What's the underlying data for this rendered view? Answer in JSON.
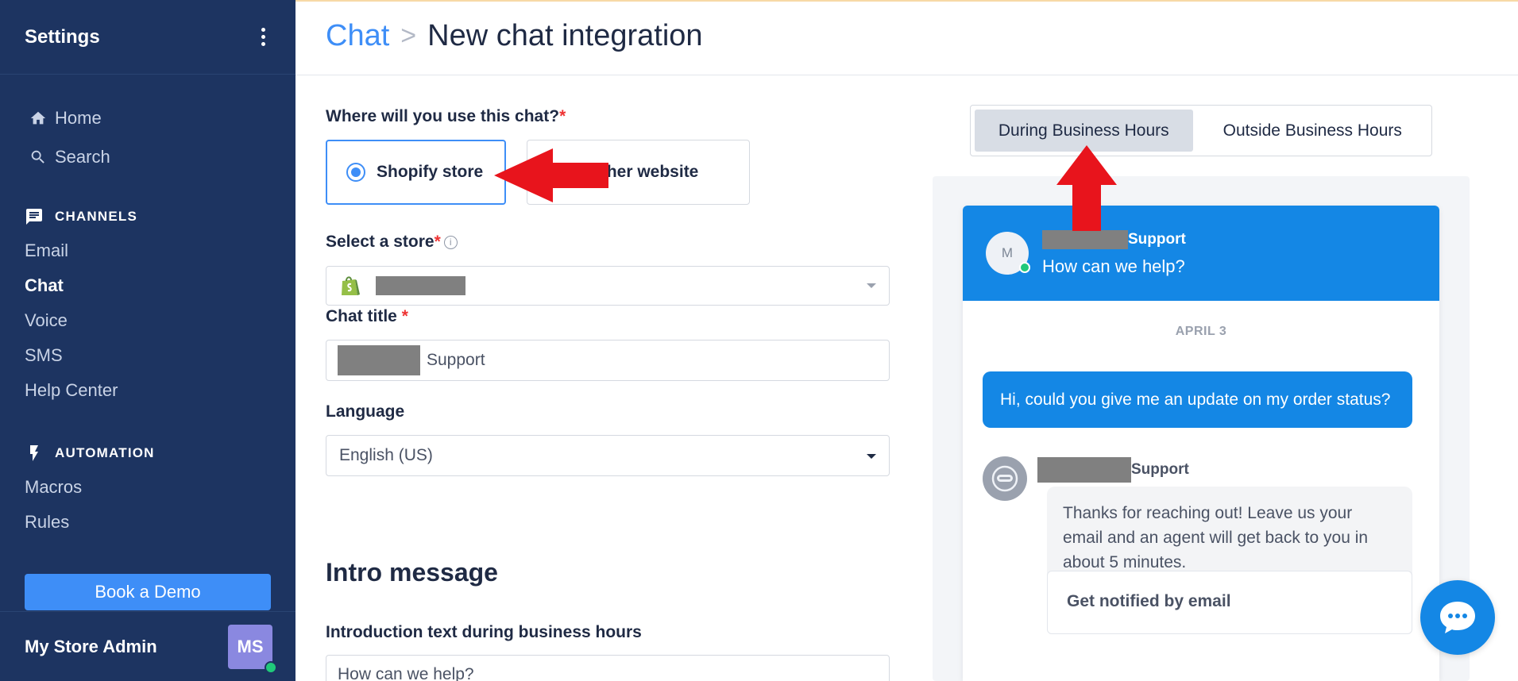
{
  "sidebar": {
    "title": "Settings",
    "nav": [
      {
        "label": "Home",
        "icon": "home-icon"
      },
      {
        "label": "Search",
        "icon": "search-icon"
      }
    ],
    "channels": {
      "heading": "CHANNELS",
      "items": [
        "Email",
        "Chat",
        "Voice",
        "SMS",
        "Help Center"
      ],
      "active": "Chat"
    },
    "automation": {
      "heading": "AUTOMATION",
      "items": [
        "Macros",
        "Rules"
      ]
    },
    "demo_button": "Book a Demo",
    "footer": {
      "name": "My Store Admin",
      "initials": "MS"
    }
  },
  "header": {
    "breadcrumb_root": "Chat",
    "separator": ">",
    "current": "New chat integration"
  },
  "form": {
    "usage_label": "Where will you use this chat?",
    "required_mark": "*",
    "options": [
      {
        "label": "Shopify store",
        "selected": true
      },
      {
        "label": "Any other website",
        "visible_label": "other website",
        "selected": false
      }
    ],
    "store_label": "Select a store",
    "info_glyph": "i",
    "chat_title_label": "Chat title",
    "chat_title_value": "Support",
    "language_label": "Language",
    "language_value": "English (US)",
    "intro_heading": "Intro message",
    "intro_label": "Introduction text during business hours",
    "intro_value": "How can we help?"
  },
  "preview": {
    "tabs": [
      {
        "label": "During Business Hours",
        "active": true
      },
      {
        "label": "Outside Business Hours",
        "active": false
      }
    ],
    "header_avatar": "M",
    "header_name": "Support",
    "header_subtitle": "How can we help?",
    "date": "APRIL 3",
    "user_message": "Hi, could you give me an update on my order status?",
    "agent_name": "Support",
    "agent_message": "Thanks for reaching out! Leave us your email and an agent will get back to you in about 5 minutes.",
    "notify_title": "Get notified by email"
  },
  "colors": {
    "sidebar_bg": "#1d3461",
    "accent": "#3e8ef7",
    "chat_blue": "#1487e5",
    "annotation_red": "#e8141c"
  }
}
